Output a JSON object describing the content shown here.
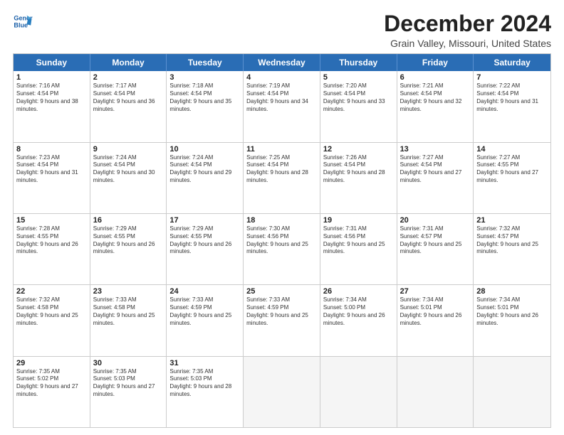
{
  "logo": {
    "line1": "General",
    "line2": "Blue"
  },
  "title": "December 2024",
  "subtitle": "Grain Valley, Missouri, United States",
  "days": [
    "Sunday",
    "Monday",
    "Tuesday",
    "Wednesday",
    "Thursday",
    "Friday",
    "Saturday"
  ],
  "weeks": [
    [
      {
        "day": "1",
        "sunrise": "7:16 AM",
        "sunset": "4:54 PM",
        "daylight": "9 hours and 38 minutes."
      },
      {
        "day": "2",
        "sunrise": "7:17 AM",
        "sunset": "4:54 PM",
        "daylight": "9 hours and 36 minutes."
      },
      {
        "day": "3",
        "sunrise": "7:18 AM",
        "sunset": "4:54 PM",
        "daylight": "9 hours and 35 minutes."
      },
      {
        "day": "4",
        "sunrise": "7:19 AM",
        "sunset": "4:54 PM",
        "daylight": "9 hours and 34 minutes."
      },
      {
        "day": "5",
        "sunrise": "7:20 AM",
        "sunset": "4:54 PM",
        "daylight": "9 hours and 33 minutes."
      },
      {
        "day": "6",
        "sunrise": "7:21 AM",
        "sunset": "4:54 PM",
        "daylight": "9 hours and 32 minutes."
      },
      {
        "day": "7",
        "sunrise": "7:22 AM",
        "sunset": "4:54 PM",
        "daylight": "9 hours and 31 minutes."
      }
    ],
    [
      {
        "day": "8",
        "sunrise": "7:23 AM",
        "sunset": "4:54 PM",
        "daylight": "9 hours and 31 minutes."
      },
      {
        "day": "9",
        "sunrise": "7:24 AM",
        "sunset": "4:54 PM",
        "daylight": "9 hours and 30 minutes."
      },
      {
        "day": "10",
        "sunrise": "7:24 AM",
        "sunset": "4:54 PM",
        "daylight": "9 hours and 29 minutes."
      },
      {
        "day": "11",
        "sunrise": "7:25 AM",
        "sunset": "4:54 PM",
        "daylight": "9 hours and 28 minutes."
      },
      {
        "day": "12",
        "sunrise": "7:26 AM",
        "sunset": "4:54 PM",
        "daylight": "9 hours and 28 minutes."
      },
      {
        "day": "13",
        "sunrise": "7:27 AM",
        "sunset": "4:54 PM",
        "daylight": "9 hours and 27 minutes."
      },
      {
        "day": "14",
        "sunrise": "7:27 AM",
        "sunset": "4:55 PM",
        "daylight": "9 hours and 27 minutes."
      }
    ],
    [
      {
        "day": "15",
        "sunrise": "7:28 AM",
        "sunset": "4:55 PM",
        "daylight": "9 hours and 26 minutes."
      },
      {
        "day": "16",
        "sunrise": "7:29 AM",
        "sunset": "4:55 PM",
        "daylight": "9 hours and 26 minutes."
      },
      {
        "day": "17",
        "sunrise": "7:29 AM",
        "sunset": "4:55 PM",
        "daylight": "9 hours and 26 minutes."
      },
      {
        "day": "18",
        "sunrise": "7:30 AM",
        "sunset": "4:56 PM",
        "daylight": "9 hours and 25 minutes."
      },
      {
        "day": "19",
        "sunrise": "7:31 AM",
        "sunset": "4:56 PM",
        "daylight": "9 hours and 25 minutes."
      },
      {
        "day": "20",
        "sunrise": "7:31 AM",
        "sunset": "4:57 PM",
        "daylight": "9 hours and 25 minutes."
      },
      {
        "day": "21",
        "sunrise": "7:32 AM",
        "sunset": "4:57 PM",
        "daylight": "9 hours and 25 minutes."
      }
    ],
    [
      {
        "day": "22",
        "sunrise": "7:32 AM",
        "sunset": "4:58 PM",
        "daylight": "9 hours and 25 minutes."
      },
      {
        "day": "23",
        "sunrise": "7:33 AM",
        "sunset": "4:58 PM",
        "daylight": "9 hours and 25 minutes."
      },
      {
        "day": "24",
        "sunrise": "7:33 AM",
        "sunset": "4:59 PM",
        "daylight": "9 hours and 25 minutes."
      },
      {
        "day": "25",
        "sunrise": "7:33 AM",
        "sunset": "4:59 PM",
        "daylight": "9 hours and 25 minutes."
      },
      {
        "day": "26",
        "sunrise": "7:34 AM",
        "sunset": "5:00 PM",
        "daylight": "9 hours and 26 minutes."
      },
      {
        "day": "27",
        "sunrise": "7:34 AM",
        "sunset": "5:01 PM",
        "daylight": "9 hours and 26 minutes."
      },
      {
        "day": "28",
        "sunrise": "7:34 AM",
        "sunset": "5:01 PM",
        "daylight": "9 hours and 26 minutes."
      }
    ],
    [
      {
        "day": "29",
        "sunrise": "7:35 AM",
        "sunset": "5:02 PM",
        "daylight": "9 hours and 27 minutes."
      },
      {
        "day": "30",
        "sunrise": "7:35 AM",
        "sunset": "5:03 PM",
        "daylight": "9 hours and 27 minutes."
      },
      {
        "day": "31",
        "sunrise": "7:35 AM",
        "sunset": "5:03 PM",
        "daylight": "9 hours and 28 minutes."
      },
      null,
      null,
      null,
      null
    ]
  ]
}
